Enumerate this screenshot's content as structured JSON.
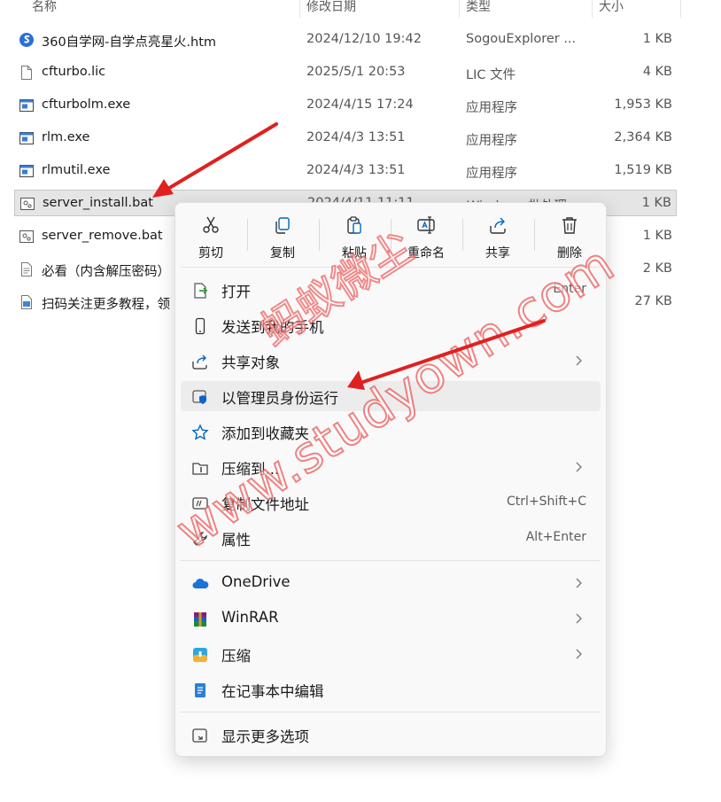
{
  "columns": {
    "name": "名称",
    "modified": "修改日期",
    "type": "类型",
    "size": "大小"
  },
  "files": [
    {
      "name": "360自学网-自学点亮星火.htm",
      "modified": "2024/12/10 19:42",
      "type": "SogouExplorer ...",
      "size": "1 KB",
      "icon": "sogou-html-icon"
    },
    {
      "name": "cfturbo.lic",
      "modified": "2025/5/1 20:53",
      "type": "LIC 文件",
      "size": "4 KB",
      "icon": "blank-file-icon"
    },
    {
      "name": "cfturbolm.exe",
      "modified": "2024/4/15 17:24",
      "type": "应用程序",
      "size": "1,953 KB",
      "icon": "exe-icon"
    },
    {
      "name": "rlm.exe",
      "modified": "2024/4/3 13:51",
      "type": "应用程序",
      "size": "2,364 KB",
      "icon": "exe-icon"
    },
    {
      "name": "rlmutil.exe",
      "modified": "2024/4/3 13:51",
      "type": "应用程序",
      "size": "1,519 KB",
      "icon": "exe-icon"
    },
    {
      "name": "server_install.bat",
      "modified": "2024/4/11 11:11",
      "type": "Windows 批处理...",
      "size": "1 KB",
      "icon": "bat-icon",
      "selected": true
    },
    {
      "name": "server_remove.bat",
      "modified": "",
      "type": "",
      "size": "1 KB",
      "icon": "bat-icon"
    },
    {
      "name": "必看（内含解压密码）",
      "modified": "",
      "type": "",
      "size": "2 KB",
      "icon": "text-file-icon"
    },
    {
      "name": "扫码关注更多教程，领",
      "modified": "",
      "type": "",
      "size": "27 KB",
      "icon": "image-file-icon"
    }
  ],
  "context_menu": {
    "quick_actions": [
      {
        "label": "剪切",
        "icon": "scissors-icon"
      },
      {
        "label": "复制",
        "icon": "copy-icon"
      },
      {
        "label": "粘贴",
        "icon": "paste-icon"
      },
      {
        "label": "重命名",
        "icon": "rename-icon"
      },
      {
        "label": "共享",
        "icon": "share-icon"
      },
      {
        "label": "删除",
        "icon": "trash-icon"
      }
    ],
    "items": [
      {
        "label": "打开",
        "shortcut": "Enter",
        "icon": "open-icon"
      },
      {
        "label": "发送到我的手机",
        "icon": "phone-icon"
      },
      {
        "label": "共享对象",
        "icon": "share-icon",
        "submenu": true
      },
      {
        "label": "以管理员身份运行",
        "icon": "shield-icon",
        "highlighted": true
      },
      {
        "label": "添加到收藏夹",
        "icon": "star-icon"
      },
      {
        "label": "压缩到...",
        "icon": "zip-folder-icon",
        "submenu": true
      },
      {
        "label": "复制文件地址",
        "shortcut": "Ctrl+Shift+C",
        "icon": "copy-path-icon"
      },
      {
        "label": "属性",
        "shortcut": "Alt+Enter",
        "icon": "wrench-icon"
      }
    ],
    "apps": [
      {
        "label": "OneDrive",
        "icon": "onedrive-icon",
        "submenu": true
      },
      {
        "label": "WinRAR",
        "icon": "winrar-icon",
        "submenu": true
      },
      {
        "label": "压缩",
        "icon": "compress-icon",
        "submenu": true
      },
      {
        "label": "在记事本中编辑",
        "icon": "notepad-icon"
      }
    ],
    "more": {
      "label": "显示更多选项",
      "icon": "more-options-icon"
    }
  },
  "watermark": {
    "text_cn": "蚂蚁微尘",
    "text_url": "www.studyown.com"
  },
  "colors": {
    "arrow": "#e02020",
    "accent": "#0067c0",
    "selected_row": "#e5e5e5"
  }
}
